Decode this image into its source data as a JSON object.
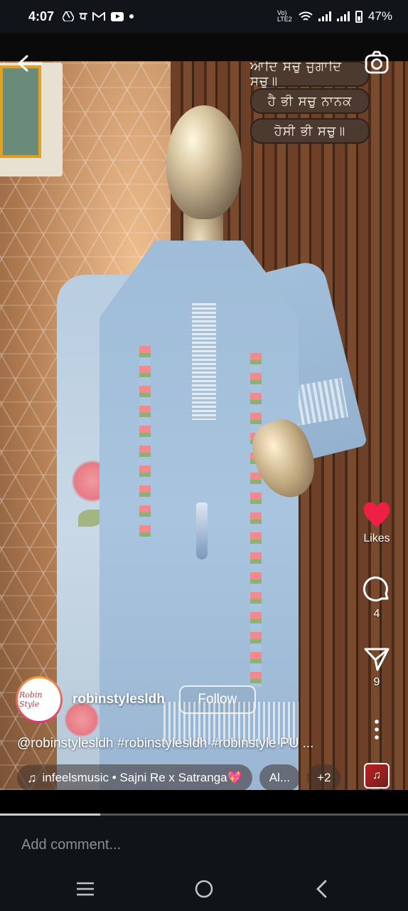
{
  "status_bar": {
    "time": "4:07",
    "network": "Vo) LTE2",
    "battery": "47%",
    "app_icons": [
      "drive-icon",
      "dh-icon",
      "gmail-icon",
      "youtube-icon",
      "dot-icon"
    ]
  },
  "reel": {
    "username": "robinstylesldh",
    "avatar_text": "Robin Style",
    "follow_label": "Follow",
    "caption": "@robinstylesldh #robinstylesldh #robinstyle PU ...",
    "wall_plaques": [
      "ਆਦਿ ਸਚੁ ਜੁਗਾਦਿ ਸਚੁ॥",
      "ਹੈ ਭੀ ਸਚੁ ਨਾਨਕ",
      "ਹੋਸੀ ਭੀ ਸਚੁ॥"
    ],
    "actions": {
      "likes_label": "Likes",
      "comments_count": "4",
      "shares_count": "9"
    },
    "music": {
      "track": "infeelsmusic • Sajni Re x Satranga💖",
      "second_pill": "Al...",
      "more_pill": "+2"
    },
    "progress": 0.245
  },
  "comment": {
    "placeholder": "Add comment..."
  },
  "colors": {
    "like": "#f01f46",
    "follow_border": "#ffffff",
    "comment_bg": "#101419"
  }
}
